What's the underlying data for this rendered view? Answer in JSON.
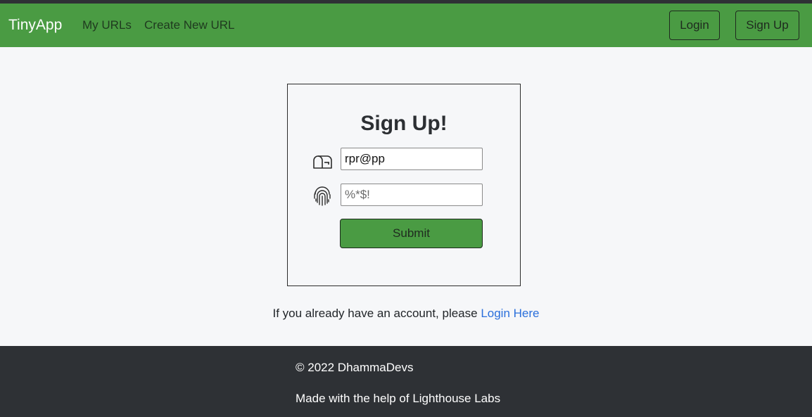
{
  "navbar": {
    "brand": "TinyApp",
    "links": [
      "My URLs",
      "Create New URL"
    ],
    "login_label": "Login",
    "signup_label": "Sign Up"
  },
  "form": {
    "title": "Sign Up!",
    "email_value": "rpr@pp",
    "password_placeholder": "%*$!",
    "submit_label": "Submit"
  },
  "login_prompt": {
    "text": "If you already have an account, please ",
    "link": "Login Here"
  },
  "footer": {
    "copyright": "© 2022 DhammaDevs",
    "credit": "Made with the help of Lighthouse Labs"
  },
  "colors": {
    "navbar": "#4a9b43",
    "footer": "#2e3135",
    "link": "#2a6fdb"
  },
  "icons": {
    "email": "mailbox-icon",
    "password": "fingerprint-icon"
  }
}
